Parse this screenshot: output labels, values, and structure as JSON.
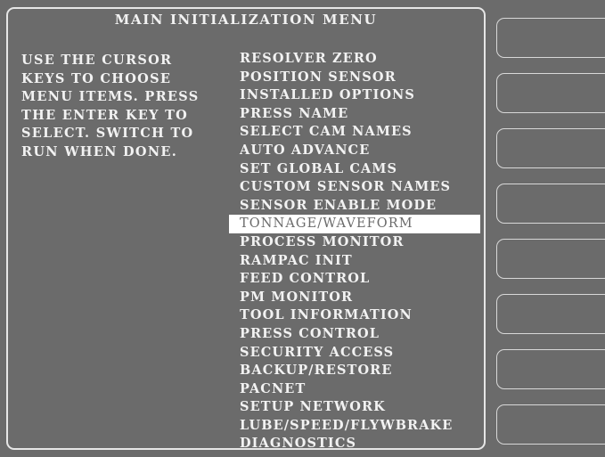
{
  "title": "MAIN INITIALIZATION MENU",
  "instructions": [
    "USE THE CURSOR",
    "KEYS TO CHOOSE",
    "MENU ITEMS. PRESS",
    "THE ENTER KEY TO",
    "SELECT. SWITCH TO",
    "RUN WHEN DONE."
  ],
  "menu": {
    "selected_index": 9,
    "items": [
      "RESOLVER ZERO",
      "POSITION SENSOR",
      "INSTALLED OPTIONS",
      "PRESS NAME",
      "SELECT CAM NAMES",
      "AUTO ADVANCE",
      "SET GLOBAL CAMS",
      "CUSTOM SENSOR NAMES",
      "SENSOR ENABLE MODE",
      "TONNAGE/WAVEFORM",
      "PROCESS MONITOR",
      "RAMPAC INIT",
      "FEED CONTROL",
      "PM MONITOR",
      "TOOL INFORMATION",
      "PRESS CONTROL",
      "SECURITY ACCESS",
      "BACKUP/RESTORE",
      "PACNET",
      "SETUP NETWORK",
      "LUBE/SPEED/FLYWBRAKE",
      "DIAGNOSTICS"
    ]
  },
  "softkeys": [
    "",
    "",
    "",
    "",
    "",
    "",
    "",
    ""
  ],
  "colors": {
    "background": "#6b6b6b",
    "text": "#f2f2f2",
    "highlight": "#ffffff"
  }
}
